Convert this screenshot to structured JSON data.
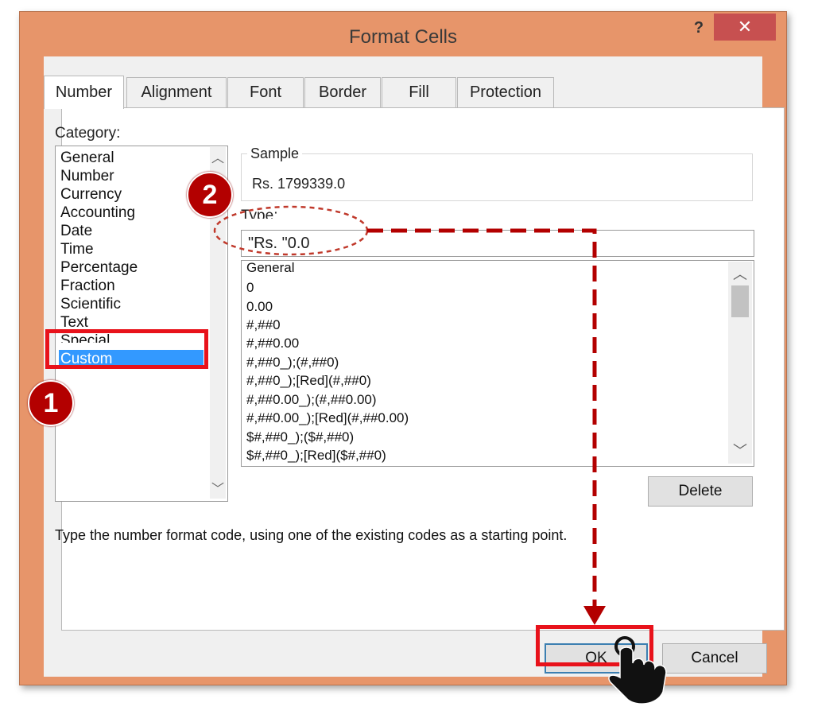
{
  "dialog": {
    "title": "Format Cells",
    "help_label": "?",
    "close_label": "✕"
  },
  "tabs": [
    {
      "label": "Number",
      "active": true
    },
    {
      "label": "Alignment",
      "active": false
    },
    {
      "label": "Font",
      "active": false
    },
    {
      "label": "Border",
      "active": false
    },
    {
      "label": "Fill",
      "active": false
    },
    {
      "label": "Protection",
      "active": false
    }
  ],
  "category": {
    "label": "Category:",
    "items": [
      "General",
      "Number",
      "Currency",
      "Accounting",
      "Date",
      "Time",
      "Percentage",
      "Fraction",
      "Scientific",
      "Text",
      "Special",
      "Custom"
    ],
    "selected": "Custom"
  },
  "sample": {
    "label": "Sample",
    "value": "Rs. 1799339.0"
  },
  "type": {
    "label": "Type:",
    "value": "\"Rs. \"0.0"
  },
  "format_list": [
    "General",
    "0",
    "0.00",
    "#,##0",
    "#,##0.00",
    "#,##0_);(#,##0)",
    "#,##0_);[Red](#,##0)",
    "#,##0.00_);(#,##0.00)",
    "#,##0.00_);[Red](#,##0.00)",
    "$#,##0_);($#,##0)",
    "$#,##0_);[Red]($#,##0)"
  ],
  "buttons": {
    "delete": "Delete",
    "ok": "OK",
    "cancel": "Cancel"
  },
  "hint_text": "Type the number format code, using one of the existing codes as a starting point.",
  "annotations": {
    "step1": "1",
    "step2": "2",
    "accent_color": "#e8121b",
    "badge_color": "#b30000"
  },
  "icons": {
    "scroll_up": "chevron-up-icon",
    "scroll_down": "chevron-down-icon",
    "pointer": "pointing-hand-icon"
  }
}
